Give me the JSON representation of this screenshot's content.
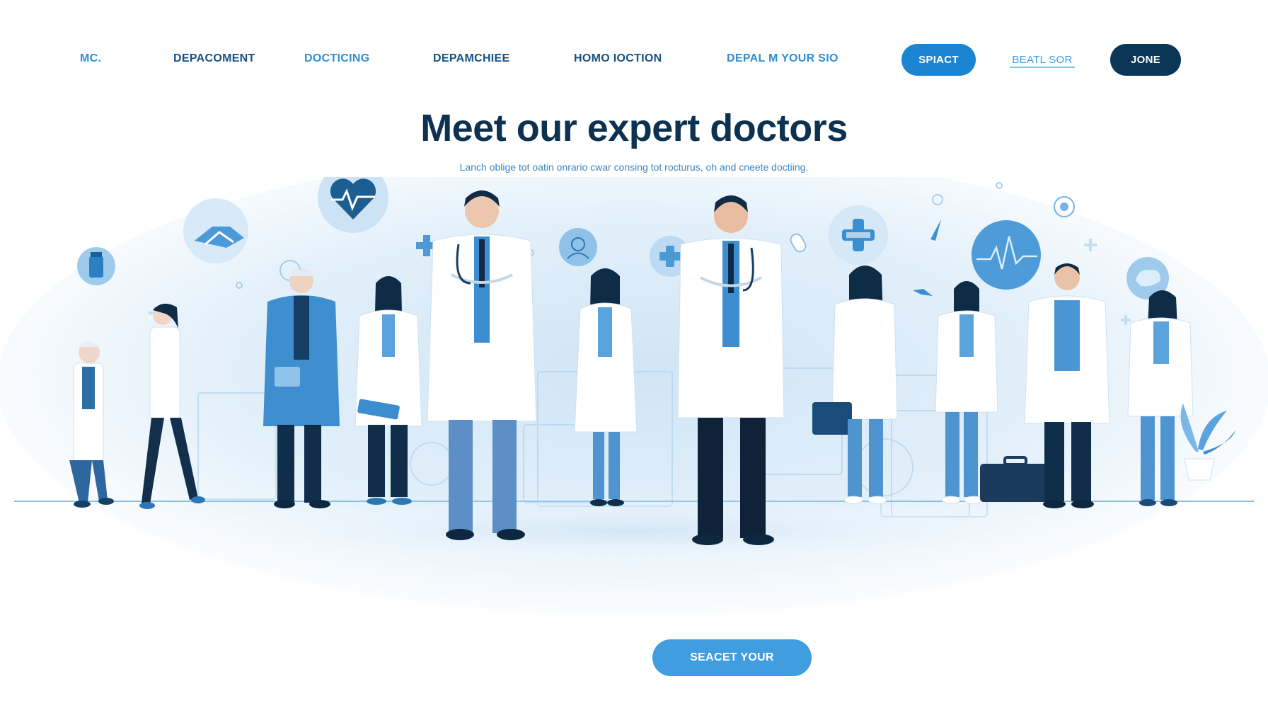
{
  "nav": {
    "links": [
      "MC.",
      "DEPACOMENT",
      "DOCTICING",
      "DEPAMCHIEE",
      "HOMO IOCTION",
      "DEPAL M YOUR SIO"
    ],
    "buttons": {
      "primary": "SPIACT",
      "outline": "BEATL SOR",
      "dark": "JONE"
    }
  },
  "hero": {
    "title": "Meet our expert doctors",
    "subtitle": "Lanch oblige tot oatin onrario cwar consing tot rocturus, oh and cneete doctiing."
  },
  "cta": {
    "label": "SEACET YOUR"
  },
  "colors": {
    "primary_blue": "#1b84d3",
    "dark_navy": "#0b3657",
    "title_navy": "#0d3150",
    "light_blue": "#cfe6f7",
    "cta_blue": "#3f9de0"
  },
  "icons": [
    "heart-pulse-icon",
    "handshake-icon",
    "medical-cross-icon",
    "doctor-avatar-icon",
    "first-aid-icon",
    "ecg-monitor-icon",
    "pill-icon",
    "medicine-bottle-icon",
    "brain-icon",
    "bird-icon",
    "molecule-icon"
  ]
}
